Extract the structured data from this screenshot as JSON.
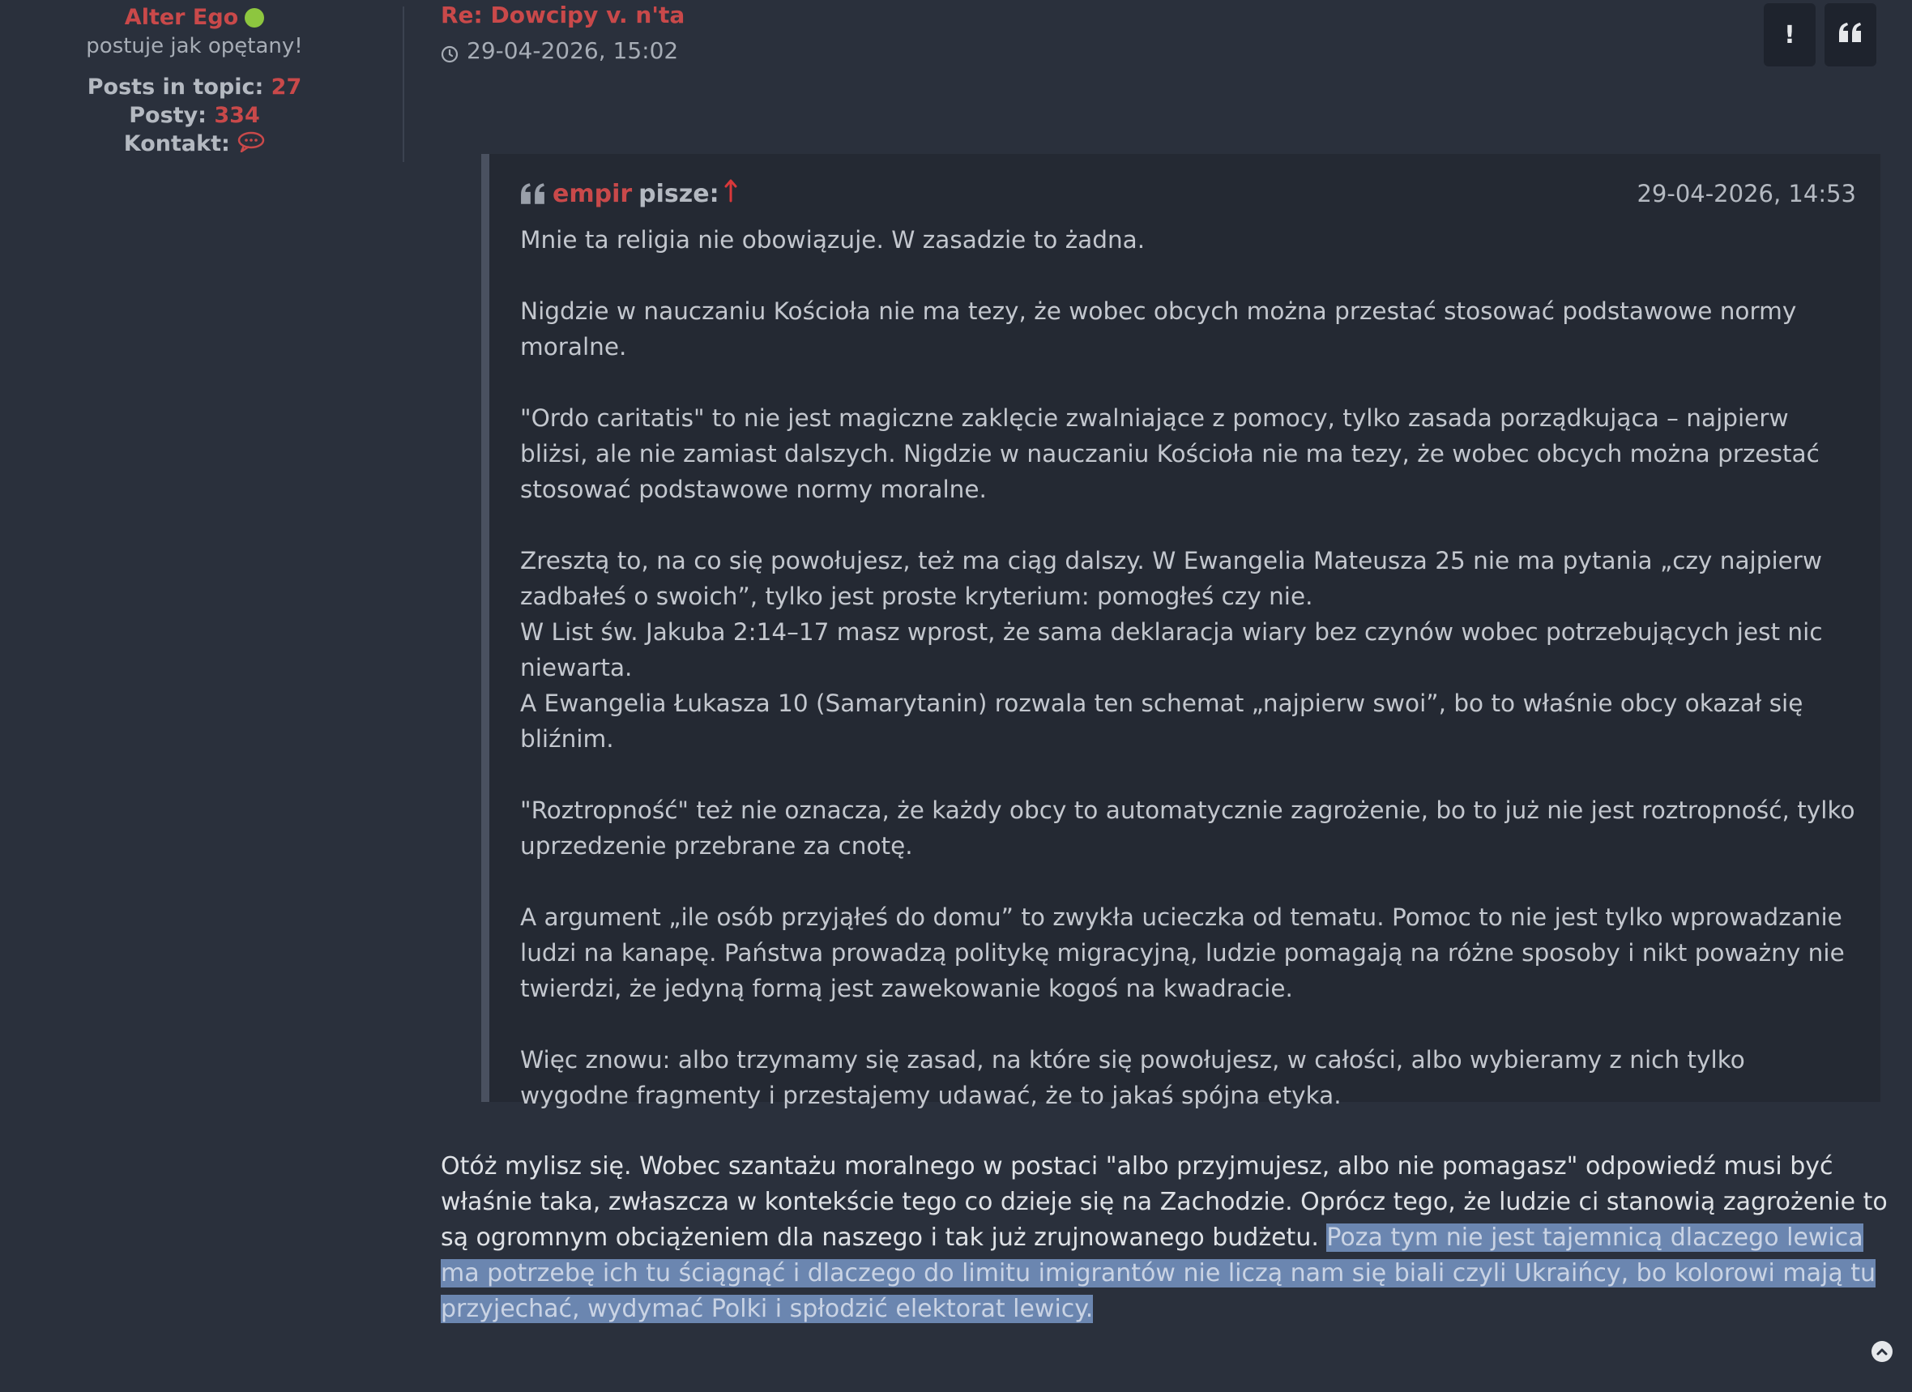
{
  "author": {
    "name": "Alter Ego",
    "online": true,
    "rank": "postuje jak opętany!",
    "posts_in_topic_label": "Posts in topic:",
    "posts_in_topic": "27",
    "posts_label": "Posty:",
    "posts": "334",
    "contact_label": "Kontakt:"
  },
  "post": {
    "title": "Re: Dowcipy v. n'ta",
    "date": "29-04-2026, 15:02",
    "report_label": "!",
    "colors": {
      "accent": "#c9494a",
      "online": "#8dc63f",
      "background": "#2a303c"
    }
  },
  "quote": {
    "author": "empir",
    "writes": "pisze:",
    "date": "29-04-2026, 14:53",
    "paragraphs": [
      "Mnie ta religia nie obowiązuje. W zasadzie to żadna.",
      "Nigdzie w nauczaniu Kościoła nie ma tezy, że wobec obcych można przestać stosować podstawowe normy moralne.",
      "\"Ordo caritatis\" to nie jest magiczne zaklęcie zwalniające z pomocy, tylko zasada porządkująca – najpierw bliżsi, ale nie zamiast dalszych. Nigdzie w nauczaniu Kościoła nie ma tezy, że wobec obcych można przestać stosować podstawowe normy moralne.",
      "Zresztą to, na co się powołujesz, też ma ciąg dalszy. W Ewangelia Mateusza 25 nie ma pytania „czy najpierw zadbałeś o swoich”, tylko jest proste kryterium: pomogłeś czy nie.\nW List św. Jakuba 2:14–17 masz wprost, że sama deklaracja wiary bez czynów wobec potrzebujących jest nic niewarta.\nA Ewangelia Łukasza 10 (Samarytanin) rozwala ten schemat „najpierw swoi”, bo to właśnie obcy okazał się bliźnim.",
      "\"Roztropność\" też nie oznacza, że każdy obcy to automatycznie zagrożenie, bo to już nie jest roztropność, tylko uprzedzenie przebrane za cnotę.",
      "A argument „ile osób przyjąłeś do domu” to zwykła ucieczka od tematu. Pomoc to nie jest tylko wprowadzanie ludzi na kanapę. Państwa prowadzą politykę migracyjną, ludzie pomagają na różne sposoby i nikt poważny nie twierdzi, że jedyną formą jest zawekowanie kogoś na kwadracie.",
      "Więc znowu: albo trzymamy się zasad, na które się powołujesz, w całości, albo wybieramy z nich tylko wygodne fragmenty i przestajemy udawać, że to jakaś spójna etyka."
    ]
  },
  "reply": {
    "text": "Otóż mylisz się. Wobec szantażu moralnego w postaci \"albo przyjmujesz, albo nie pomagasz\" odpowiedź musi być właśnie taka, zwłaszcza w kontekście tego co dzieje się na Zachodzie. Oprócz tego, że ludzie ci stanowią zagrożenie to są ogromnym obciążeniem dla naszego i tak już zrujnowanego budżetu. ",
    "selected_text": "Poza tym nie jest tajemnicą dlaczego lewica ma potrzebę ich tu ściągnąć i dlaczego do limitu imigrantów nie liczą nam się biali czyli Ukraińcy, bo kolorowi mają tu przyjechać, wydymać Polki i spłodzić elektorat lewicy."
  }
}
